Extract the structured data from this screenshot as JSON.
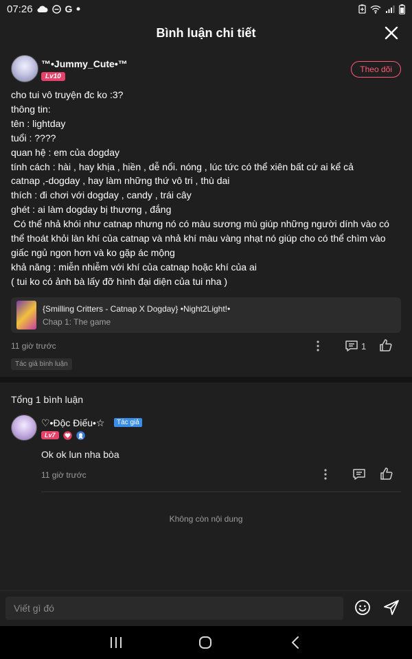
{
  "status_bar": {
    "time": "07:26",
    "left_icons": [
      "cloud-icon",
      "minus-circle-icon",
      "google-g-icon",
      "dot-icon"
    ],
    "google_letter": "G",
    "right_icons": [
      "battery-saver-icon",
      "wifi-icon",
      "signal-icon",
      "battery-icon"
    ]
  },
  "topbar": {
    "title": "Bình luận chi tiết",
    "close_icon": "close-icon"
  },
  "comment": {
    "author": "™•Jummy_Cute•™",
    "level": "Lv10",
    "follow_label": "Theo dõi",
    "lines": [
      "cho tui vô truyện đc ko :3?",
      "thông tin:",
      "tên : lightday",
      "tuổi : ????",
      "quan hệ : em của dogday",
      "tính cách : hài , hay khịa , hiền , dễ nổi. nóng , lúc tức có thể xiên bất cứ ai kể cả",
      "catnap ,-dogday , hay làm những thứ vô tri , thù dai",
      "thích : đi chơi với dogday , candy , trái cây",
      "ghét : ai làm dogday bị thương , đắng",
      " Có thể nhả khói như catnap nhưng nó có màu sương mù giúp những người dính vào có",
      "thể thoát khỏi làn khí của catnap và nhả khí màu vàng nhạt nó giúp cho có thể chìm vào",
      "giấc ngủ ngon hơn và ko gặp ác mộng",
      "khả năng : miễn nhiễm với khí của catnap hoặc khí của ai",
      "( tui ko có ảnh bà lấy đỡ hình đại diện của tui nha )"
    ],
    "story": {
      "title": "{Smilling Critters - Catnap X Dogday} •Night2Light!•",
      "chapter": "Chap 1: The game"
    },
    "time": "11 giờ trước",
    "reply_count": "1",
    "tag": "Tác giả bình luận"
  },
  "replies_section": {
    "total_label": "Tổng 1 bình luận",
    "end_label": "Không còn nội dung"
  },
  "reply": {
    "author": "♡•Độc Điếu•☆",
    "author_tag": "Tác giả",
    "level": "Lv7",
    "text": "Ok ok lun nha bòa",
    "time": "11 giờ trước"
  },
  "composer": {
    "placeholder": "Viết gì đó"
  },
  "colors": {
    "background": "#1f1f1f",
    "accent_pink": "#ff5a77",
    "level_badge": "#e6436a",
    "author_tag_blue": "#3a8ee8"
  }
}
